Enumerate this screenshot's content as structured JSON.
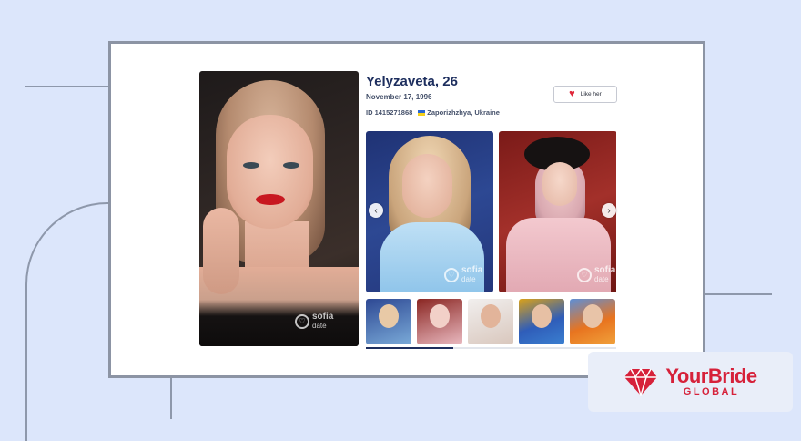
{
  "profile": {
    "name_age": "Yelyzaveta, 26",
    "birth_date": "November 17, 1996",
    "id": "ID 1415271868",
    "location": "Zaporizhzhya, Ukraine",
    "like_label": "Like her"
  },
  "watermark": {
    "brand": "sofia",
    "sub": "date"
  },
  "gallery": {
    "prev_icon": "chevron-left-icon",
    "next_icon": "chevron-right-icon",
    "thumbnail_count": 5,
    "progress_fraction": 0.35
  },
  "badge": {
    "main": "YourBride",
    "sub": "GLOBAL",
    "color": "#d6213a"
  },
  "colors": {
    "background": "#dce6fb",
    "name_text": "#1d2e5e",
    "heart": "#e0283b"
  }
}
